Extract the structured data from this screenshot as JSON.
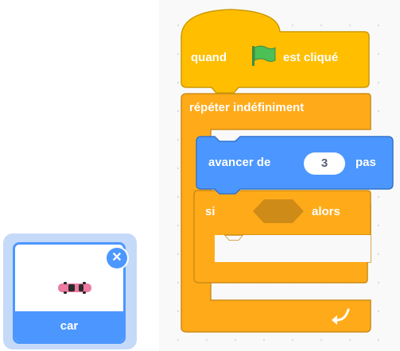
{
  "blocks": {
    "hat": {
      "before": "quand",
      "after": "est cliqué",
      "icon": "green-flag-icon"
    },
    "forever": {
      "label": "répéter indéfiniment",
      "icon": "loop-arrow-icon"
    },
    "move": {
      "before": "avancer de",
      "value": "3",
      "after": "pas"
    },
    "if": {
      "before": "si",
      "after": "alors"
    }
  },
  "sprite": {
    "name": "car",
    "icon": "car-icon",
    "delete_icon": "close-icon"
  },
  "colors": {
    "control": "#ffab19",
    "control_dark": "#cf8b17",
    "events": "#ffbf00",
    "motion": "#4c97ff",
    "flag": "#4cbf56",
    "selected": "#4c97ff"
  }
}
